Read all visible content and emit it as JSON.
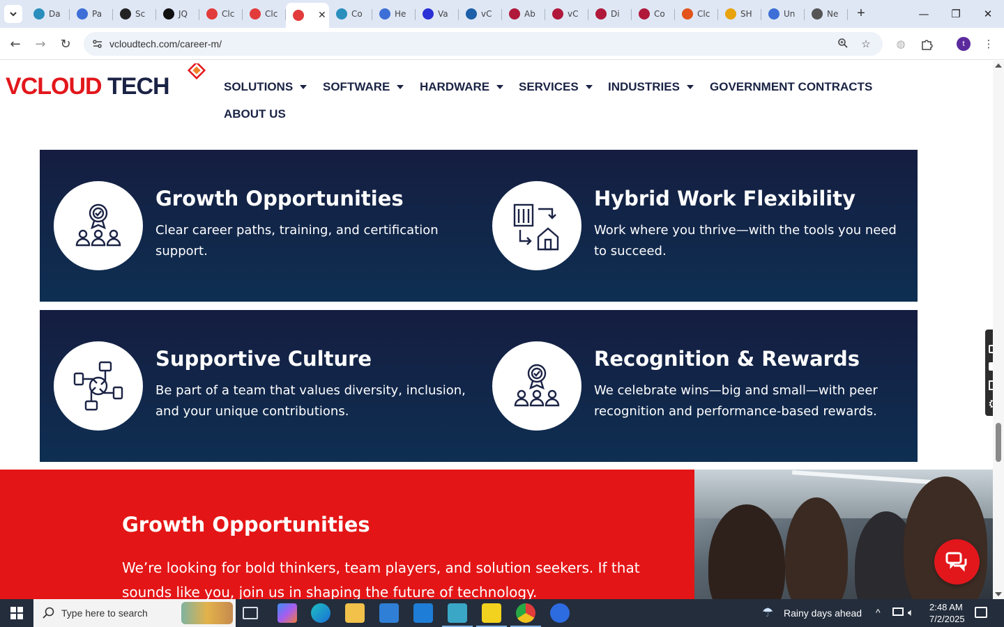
{
  "browser": {
    "tabs": [
      {
        "label": "Da",
        "color": "#2a8fbd"
      },
      {
        "label": "Pa",
        "color": "#3d6fd6"
      },
      {
        "label": "Sc",
        "color": "#222222"
      },
      {
        "label": "JQ",
        "color": "#111111"
      },
      {
        "label": "Clc",
        "color": "#e23b3b"
      },
      {
        "label": "Clc",
        "color": "#e23b3b"
      },
      {
        "label": "",
        "color": "#e23b3b"
      },
      {
        "label": "Co",
        "color": "#2a8fbd"
      },
      {
        "label": "He",
        "color": "#3d6fd6"
      },
      {
        "label": "Va",
        "color": "#2a2fd6"
      },
      {
        "label": "vC",
        "color": "#1d5fa8"
      },
      {
        "label": "Ab",
        "color": "#b0193a"
      },
      {
        "label": "vC",
        "color": "#b0193a"
      },
      {
        "label": "Di",
        "color": "#b0193a"
      },
      {
        "label": "Co",
        "color": "#b0193a"
      },
      {
        "label": "Clc",
        "color": "#e2541c"
      },
      {
        "label": "SH",
        "color": "#e8a30c"
      },
      {
        "label": "Un",
        "color": "#3d6fd6"
      },
      {
        "label": "Ne",
        "color": "#555555"
      }
    ],
    "active_tab_close": "✕",
    "url": "vcloudtech.com/career-m/",
    "profile_initial": "t"
  },
  "site": {
    "logo": {
      "part1": "V",
      "part2": "CLOUD",
      "part3": " TECH"
    },
    "menu": [
      {
        "label": "SOLUTIONS",
        "has_caret": true
      },
      {
        "label": "SOFTWARE",
        "has_caret": true
      },
      {
        "label": "HARDWARE",
        "has_caret": true
      },
      {
        "label": "SERVICES",
        "has_caret": true
      },
      {
        "label": "INDUSTRIES",
        "has_caret": true
      },
      {
        "label": "GOVERNMENT CONTRACTS",
        "has_caret": false
      },
      {
        "label": "ABOUT US",
        "has_caret": false
      }
    ],
    "benefits": [
      {
        "title": "Growth Opportunities",
        "text": "Clear career paths, training, and certification support.",
        "icon": "award-team-icon"
      },
      {
        "title": "Hybrid Work Flexibility",
        "text": "Work where you thrive—with the tools you need to succeed.",
        "icon": "office-home-icon"
      },
      {
        "title": "Supportive Culture",
        "text": "Be part of a team that values diversity, inclusion, and your unique contributions.",
        "icon": "joined-hands-icon"
      },
      {
        "title": "Recognition & Rewards",
        "text": "We celebrate wins—big and small—with peer recognition and performance-based rewards.",
        "icon": "award-team-icon"
      }
    ],
    "section": {
      "title": "Growth Opportunities",
      "text": "We’re looking for bold thinkers, team players, and solution seekers. If that sounds like you, join us in shaping the future of technology."
    },
    "colors": {
      "navy": "#151d40",
      "red": "#e41516",
      "brand_red": "#e2171c"
    }
  },
  "taskbar": {
    "search_placeholder": "Type here to search",
    "weather": "Rainy days ahead",
    "time": "2:48 AM",
    "date": "7/2/2025"
  }
}
